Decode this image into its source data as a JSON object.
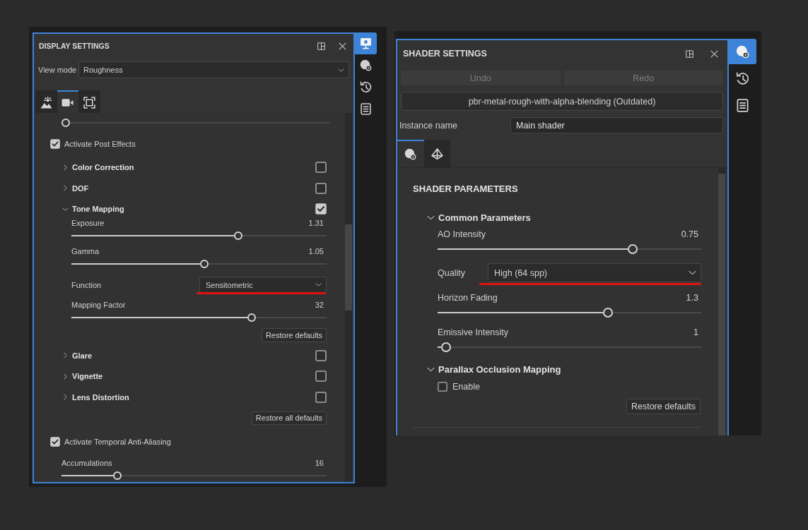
{
  "display_settings": {
    "title": "DISPLAY SETTINGS",
    "view_mode": {
      "label": "View mode",
      "value": "Roughness"
    },
    "tabs": [
      {
        "selected": false
      },
      {
        "selected": true
      },
      {
        "selected": false
      }
    ],
    "side_tabs": [
      {
        "selected": true
      },
      {
        "selected": false
      },
      {
        "selected": false
      },
      {
        "selected": false
      }
    ],
    "partial_slider": {
      "level": 0
    },
    "post_effects": {
      "label": "Activate Post Effects",
      "checked": true
    },
    "effects": [
      {
        "title": "Color Correction",
        "expanded": false,
        "checked": false
      },
      {
        "title": "DOF",
        "expanded": false,
        "checked": false
      },
      {
        "title": "Tone Mapping",
        "expanded": true,
        "checked": true,
        "params": [
          {
            "kind": "slider",
            "label": "Exposure",
            "value": "1.31",
            "level": 0.65
          },
          {
            "kind": "slider",
            "label": "Gamma",
            "value": "1.05",
            "level": 0.52
          },
          {
            "kind": "dropdown",
            "label": "Function",
            "value": "Sensitometric",
            "underlined": true
          },
          {
            "kind": "slider",
            "label": "Mapping Factor",
            "value": "32",
            "level": 0.7
          }
        ],
        "restore_button": "Restore defaults"
      },
      {
        "title": "Glare",
        "expanded": false,
        "checked": false
      },
      {
        "title": "Vignette",
        "expanded": false,
        "checked": false
      },
      {
        "title": "Lens Distortion",
        "expanded": false,
        "checked": false
      }
    ],
    "restore_all_button": "Restore all defaults",
    "taa": {
      "label": "Activate Temporal Anti-Aliasing",
      "checked": true
    },
    "accumulations": {
      "label": "Accumulations",
      "value": "16",
      "level": 0.22
    }
  },
  "shader_settings": {
    "title": "SHADER SETTINGS",
    "side_tabs": [
      {
        "selected": true
      },
      {
        "selected": false
      },
      {
        "selected": false
      }
    ],
    "undo_button": {
      "label": "Undo",
      "disabled": true
    },
    "redo_button": {
      "label": "Redo",
      "disabled": true
    },
    "shader_button": "pbr-metal-rough-with-alpha-blending (Outdated)",
    "instance_name": {
      "label": "Instance name",
      "value": "Main shader"
    },
    "tabs": [
      {
        "selected": true
      },
      {
        "selected": false
      }
    ],
    "heading": "SHADER PARAMETERS",
    "groups": [
      {
        "title": "Common Parameters",
        "expanded": true,
        "params": [
          {
            "kind": "slider",
            "label": "AO Intensity",
            "value": "0.75",
            "level": 0.73
          },
          {
            "kind": "dropdown",
            "label": "Quality",
            "value": "High (64 spp)",
            "underlined": true
          },
          {
            "kind": "slider",
            "label": "Horizon Fading",
            "value": "1.3",
            "level": 0.64
          },
          {
            "kind": "slider",
            "label": "Emissive Intensity",
            "value": "1",
            "level": 0.05
          }
        ]
      },
      {
        "title": "Parallax Occlusion Mapping",
        "expanded": true,
        "params": [
          {
            "kind": "checkbox",
            "label": "Enable",
            "checked": false
          }
        ],
        "restore_button": "Restore defaults"
      }
    ]
  }
}
